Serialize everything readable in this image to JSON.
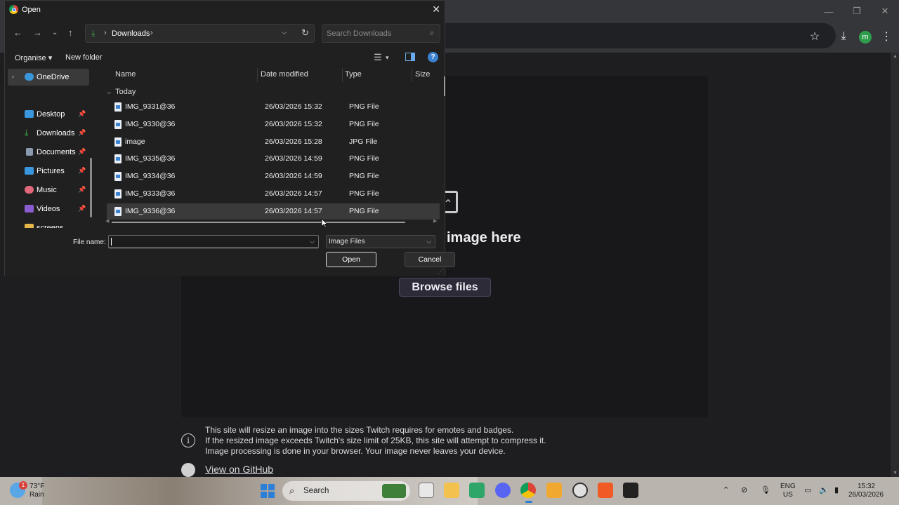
{
  "dialog": {
    "title": "Open",
    "breadcrumb": "Downloads",
    "search_placeholder": "Search Downloads",
    "toolbar": {
      "organise": "Organise",
      "new_folder": "New folder"
    },
    "nav": [
      {
        "label": "OneDrive",
        "icon": "cloud-icon",
        "color": "#3a96dd",
        "selected": true,
        "pinned": false
      },
      {
        "label": "Desktop",
        "icon": "desktop-icon",
        "color": "#3a96dd",
        "pinned": true
      },
      {
        "label": "Downloads",
        "icon": "download-icon",
        "color": "#3fb950",
        "pinned": true
      },
      {
        "label": "Documents",
        "icon": "document-icon",
        "color": "#8a9bb0",
        "pinned": true
      },
      {
        "label": "Pictures",
        "icon": "picture-icon",
        "color": "#3a96dd",
        "pinned": true
      },
      {
        "label": "Music",
        "icon": "music-icon",
        "color": "#e0687a",
        "pinned": true
      },
      {
        "label": "Videos",
        "icon": "video-icon",
        "color": "#8a5cd0",
        "pinned": true
      },
      {
        "label": "screens",
        "icon": "folder-icon",
        "color": "#e6b84a",
        "pinned": false
      }
    ],
    "columns": {
      "name": "Name",
      "date": "Date modified",
      "type": "Type",
      "size": "Size"
    },
    "group": "Today",
    "files": [
      {
        "name": "IMG_9331@36",
        "date": "26/03/2026 15:32",
        "type": "PNG File"
      },
      {
        "name": "IMG_9330@36",
        "date": "26/03/2026 15:32",
        "type": "PNG File"
      },
      {
        "name": "image",
        "date": "26/03/2026 15:28",
        "type": "JPG File"
      },
      {
        "name": "IMG_9335@36",
        "date": "26/03/2026 14:59",
        "type": "PNG File"
      },
      {
        "name": "IMG_9334@36",
        "date": "26/03/2026 14:59",
        "type": "PNG File"
      },
      {
        "name": "IMG_9333@36",
        "date": "26/03/2026 14:57",
        "type": "PNG File"
      },
      {
        "name": "IMG_9336@36",
        "date": "26/03/2026 14:57",
        "type": "PNG File"
      }
    ],
    "file_name_label": "File name:",
    "file_name_value": "",
    "file_type": "Image Files",
    "open": "Open",
    "cancel": "Cancel"
  },
  "page": {
    "drop_title": "image here",
    "browse": "Browse files",
    "info": [
      "This site will resize an image into the sizes Twitch requires for emotes and badges.",
      "If the resized image exceeds Twitch's size limit of 25KB, this site will attempt to compress it.",
      "Image processing is done in your browser. Your image never leaves your device."
    ],
    "github": "View on GitHub",
    "profile_initial": "m"
  },
  "taskbar": {
    "weather_badge": "1",
    "temp": "73°F",
    "condition": "Rain",
    "search": "Search",
    "lang1": "ENG",
    "lang2": "US",
    "time": "15:32",
    "date": "26/03/2026"
  },
  "colors": {
    "accent": "#2b7fd8",
    "dialog_bg": "#202020",
    "selected_row": "#3a3a3a"
  }
}
